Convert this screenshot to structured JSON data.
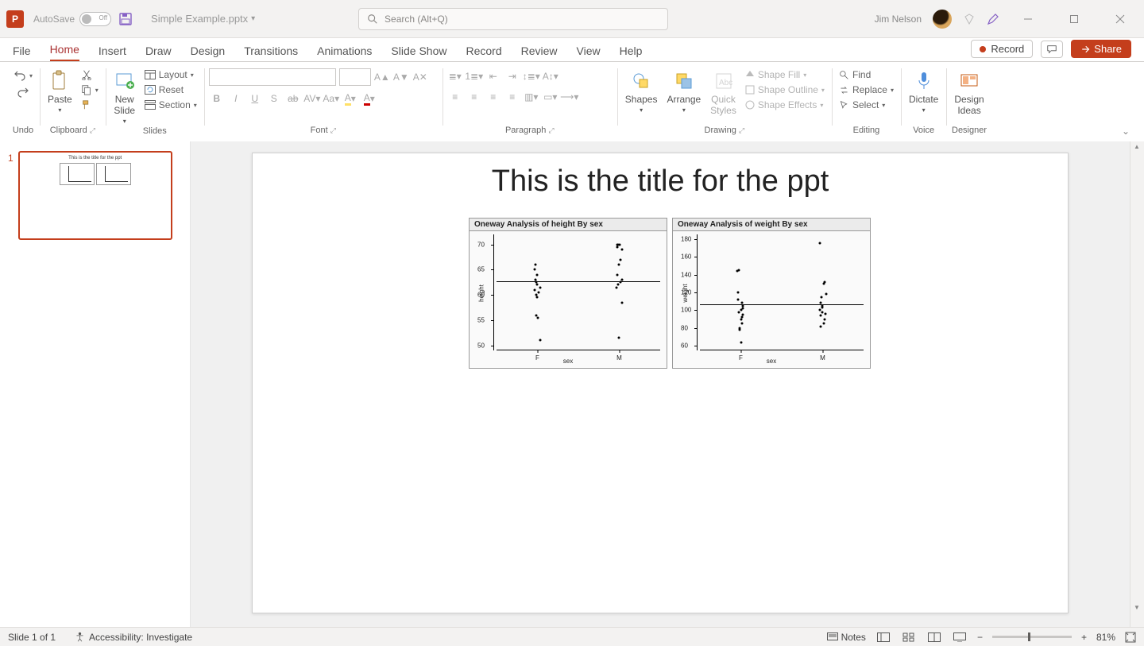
{
  "title_bar": {
    "autosave_label": "AutoSave",
    "autosave_state": "Off",
    "filename": "Simple Example.pptx",
    "search_placeholder": "Search (Alt+Q)",
    "user_name": "Jim Nelson"
  },
  "tabs": {
    "items": [
      "File",
      "Home",
      "Insert",
      "Draw",
      "Design",
      "Transitions",
      "Animations",
      "Slide Show",
      "Record",
      "Review",
      "View",
      "Help"
    ],
    "active_index": 1,
    "record_button": "Record",
    "share_button": "Share"
  },
  "ribbon": {
    "undo": {
      "label": "Undo"
    },
    "clipboard": {
      "label": "Clipboard",
      "paste": "Paste"
    },
    "slides": {
      "label": "Slides",
      "new_slide": "New\nSlide",
      "layout": "Layout",
      "reset": "Reset",
      "section": "Section"
    },
    "font": {
      "label": "Font"
    },
    "paragraph": {
      "label": "Paragraph"
    },
    "drawing": {
      "label": "Drawing",
      "shapes": "Shapes",
      "arrange": "Arrange",
      "quick_styles": "Quick\nStyles",
      "shape_fill": "Shape Fill",
      "shape_outline": "Shape Outline",
      "shape_effects": "Shape Effects"
    },
    "editing": {
      "label": "Editing",
      "find": "Find",
      "replace": "Replace",
      "select": "Select"
    },
    "voice": {
      "label": "Voice",
      "dictate": "Dictate"
    },
    "designer": {
      "label": "Designer",
      "design_ideas": "Design\nIdeas"
    }
  },
  "slide": {
    "title": "This is the title for the ppt",
    "thumb_number": "1"
  },
  "status": {
    "slide_counter": "Slide 1 of 1",
    "accessibility": "Accessibility: Investigate",
    "notes": "Notes",
    "zoom_pct": "81%"
  },
  "chart_data": [
    {
      "type": "scatter",
      "title": "Oneway Analysis of height By sex",
      "xlabel": "sex",
      "ylabel": "height",
      "categories": [
        "F",
        "M"
      ],
      "y_ticks": [
        50,
        55,
        60,
        65,
        70
      ],
      "ylim": [
        49,
        72
      ],
      "mean_line": 62.5,
      "series": [
        {
          "name": "F",
          "values": [
            66,
            65,
            64,
            63,
            62.5,
            62,
            61.5,
            61,
            60.5,
            60,
            59.5,
            56,
            55.5,
            51
          ]
        },
        {
          "name": "M",
          "values": [
            70,
            70,
            70,
            69.5,
            69,
            67,
            66,
            64,
            63,
            62.5,
            62,
            61.5,
            58.5,
            51.5
          ]
        }
      ]
    },
    {
      "type": "scatter",
      "title": "Oneway Analysis of weight By sex",
      "xlabel": "sex",
      "ylabel": "weight",
      "categories": [
        "F",
        "M"
      ],
      "y_ticks": [
        60,
        80,
        100,
        120,
        140,
        160,
        180
      ],
      "ylim": [
        55,
        185
      ],
      "mean_line": 106,
      "series": [
        {
          "name": "F",
          "values": [
            145,
            144,
            120,
            112,
            108,
            105,
            102,
            100,
            98,
            95,
            92,
            90,
            85,
            80,
            78,
            64
          ]
        },
        {
          "name": "M",
          "values": [
            175,
            132,
            130,
            118,
            115,
            108,
            105,
            103,
            100,
            98,
            96,
            94,
            90,
            85,
            82
          ]
        }
      ]
    }
  ]
}
